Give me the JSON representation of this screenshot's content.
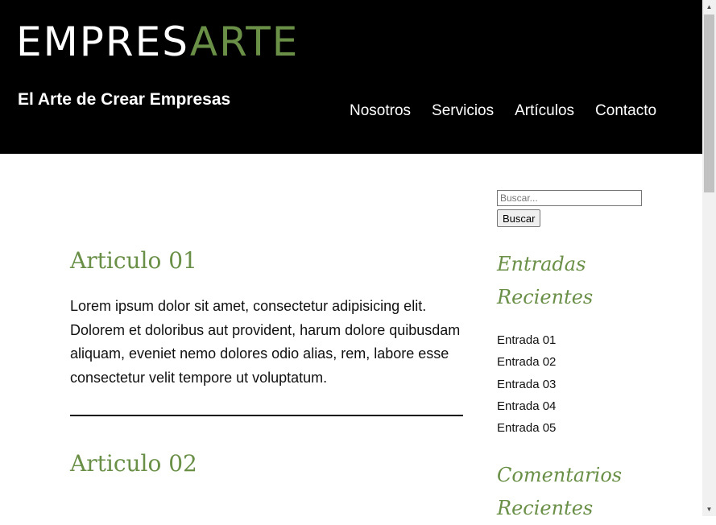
{
  "header": {
    "logo_part1": "EMPRES",
    "logo_part2": "ARTE",
    "tagline": "El Arte de Crear Empresas",
    "nav": [
      "Nosotros",
      "Servicios",
      "Artículos",
      "Contacto"
    ]
  },
  "articles": [
    {
      "title": "Articulo 01",
      "body": "Lorem ipsum dolor sit amet, consectetur adipisicing elit. Dolorem et doloribus aut provident, harum dolore quibusdam aliquam, eveniet nemo dolores odio alias, rem, labore esse consectetur velit tempore ut voluptatum."
    },
    {
      "title": "Articulo 02"
    }
  ],
  "sidebar": {
    "search_placeholder": "Buscar...",
    "search_button": "Buscar",
    "recent_entries_heading_line1": "Entradas",
    "recent_entries_heading_line2": "Recientes",
    "entries": [
      "Entrada 01",
      "Entrada 02",
      "Entrada 03",
      "Entrada 04",
      "Entrada 05"
    ],
    "recent_comments_heading_line1": "Comentarios",
    "recent_comments_heading_line2": "Recientes"
  },
  "colors": {
    "accent": "#6a8f47",
    "header_bg": "#000000"
  },
  "icons": {
    "scroll_up": "triangle-up-icon",
    "scroll_down": "triangle-down-icon"
  }
}
